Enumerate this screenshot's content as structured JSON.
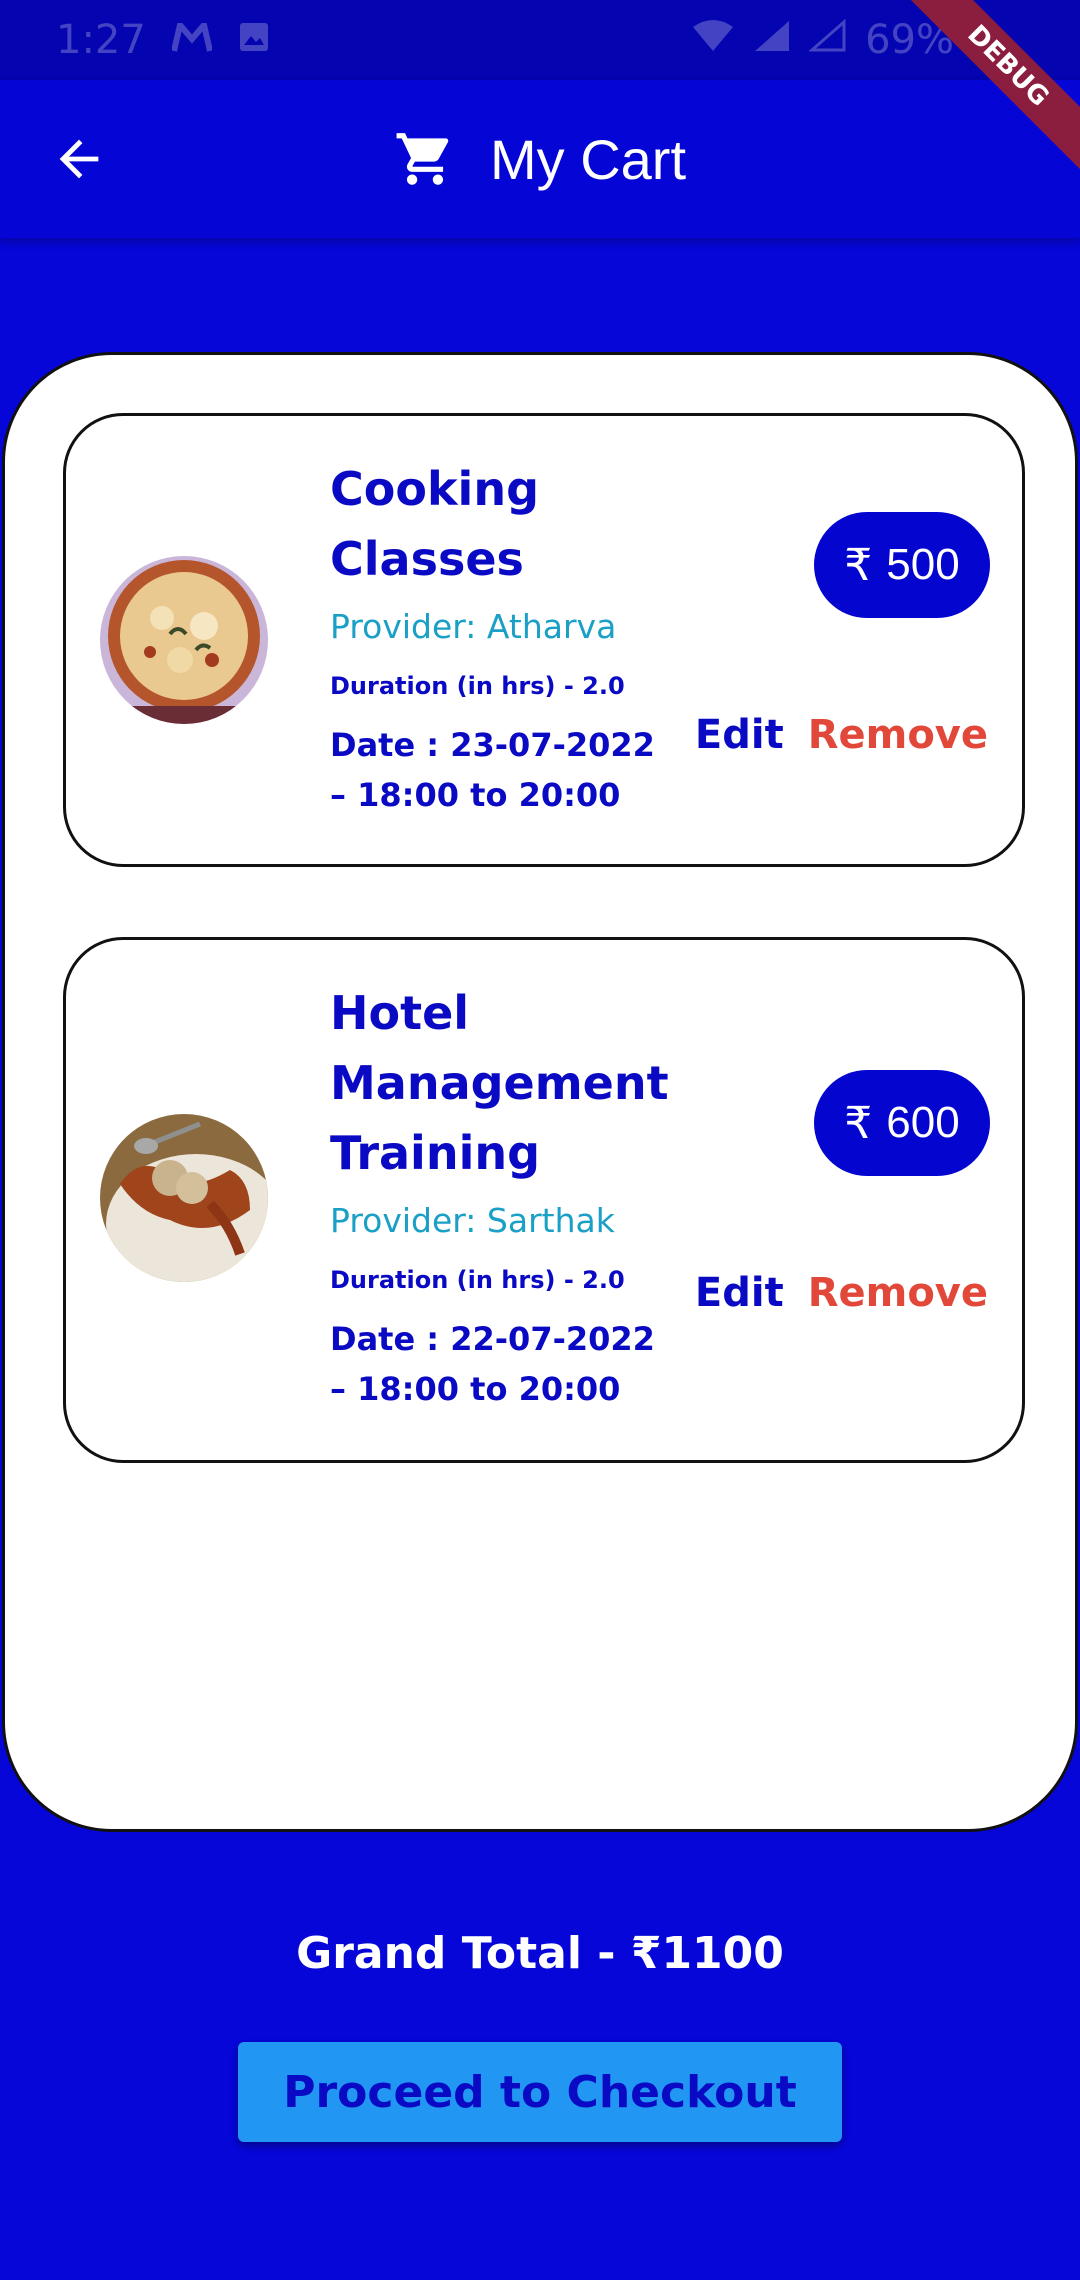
{
  "status_bar": {
    "time": "1:27",
    "battery": "69%",
    "icons": [
      "gmail-icon",
      "image-icon",
      "wifi-icon",
      "signal-icon",
      "signal-empty-icon"
    ]
  },
  "debug_banner": "DEBUG",
  "app_bar": {
    "title": "My Cart",
    "back_icon": "arrow-left-icon",
    "cart_icon": "shopping-cart-icon"
  },
  "cart_items": [
    {
      "title_line1": "Cooking",
      "title_line2": "Classes",
      "provider": "Provider: Atharva",
      "duration": "Duration (in hrs) - 2.0",
      "date_line1": "Date : 23-07-2022",
      "date_line2": "– 18:00 to 20:00",
      "currency": "₹",
      "price": "500",
      "edit_label": "Edit",
      "remove_label": "Remove",
      "image": "pizza-image"
    },
    {
      "title_line1": "Hotel",
      "title_line2": "Management",
      "title_line3": "Training",
      "provider": "Provider: Sarthak",
      "duration": "Duration (in hrs) - 2.0",
      "date_line1": "Date : 22-07-2022",
      "date_line2": "– 18:00 to 20:00",
      "currency": "₹",
      "price": "600",
      "edit_label": "Edit",
      "remove_label": "Remove",
      "image": "plated-food-image"
    }
  ],
  "grand_total": "Grand Total - ₹1100",
  "checkout_label": "Proceed to Checkout",
  "colors": {
    "primary": "#0606d8",
    "text_blue": "#0a0ac4",
    "provider_teal": "#1aa0c6",
    "remove_red": "#e2483a",
    "checkout_button": "#2196f3"
  }
}
